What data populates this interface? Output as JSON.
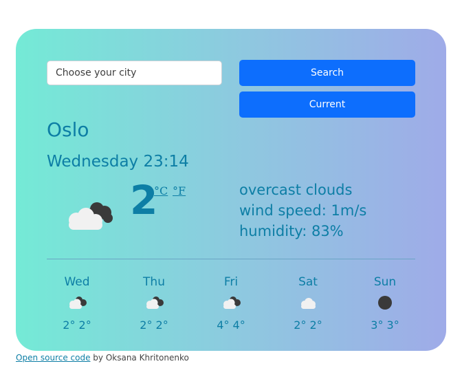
{
  "search": {
    "placeholder": "Choose your city",
    "search_label": "Search",
    "current_label": "Current"
  },
  "current": {
    "city": "Oslo",
    "datetime": "Wednesday 23:14",
    "temperature": "2",
    "unit_celsius": "°C",
    "unit_fahrenheit": "°F",
    "icon": "overcast-clouds-icon",
    "description": "overcast clouds",
    "wind": "wind speed: 1m/s",
    "humidity": "humidity: 83%"
  },
  "forecast": [
    {
      "day": "Wed",
      "icon": "broken-clouds-icon",
      "temps": "2° 2°"
    },
    {
      "day": "Thu",
      "icon": "broken-clouds-icon",
      "temps": "2° 2°"
    },
    {
      "day": "Fri",
      "icon": "broken-clouds-icon",
      "temps": "4° 4°"
    },
    {
      "day": "Sat",
      "icon": "cloud-icon",
      "temps": "2° 2°"
    },
    {
      "day": "Sun",
      "icon": "dark-circle-icon",
      "temps": "3° 3°"
    }
  ],
  "footer": {
    "link_text": "Open source code",
    "author_text": " by Oksana Khritonenko"
  },
  "colors": {
    "accent_text": "#0d7ea5",
    "button": "#0d6efd",
    "gradient_start": "#74ead6",
    "gradient_end": "#9fabe8"
  }
}
